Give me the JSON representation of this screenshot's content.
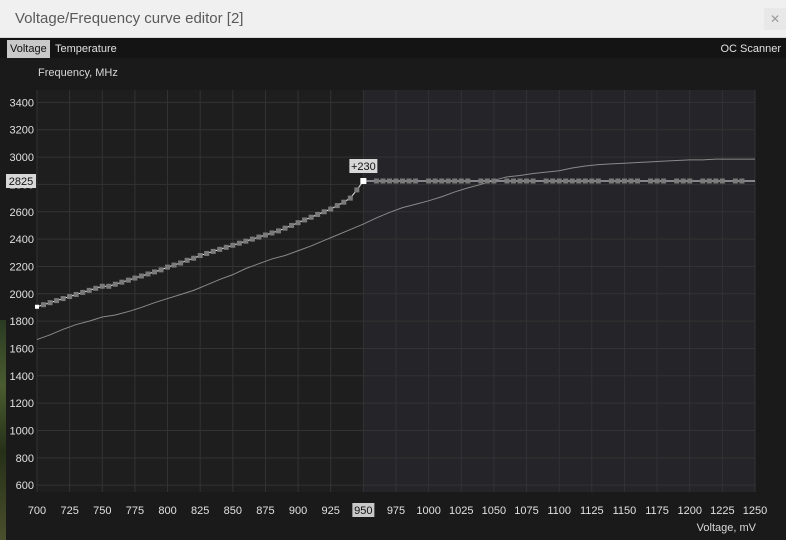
{
  "window": {
    "title": "Voltage/Frequency curve editor [2]",
    "close_icon": "close-icon"
  },
  "tabs": {
    "voltage": "Voltage",
    "temperature": "Temperature",
    "oc_scanner": "OC Scanner"
  },
  "colors": {
    "background": "#1a1a1a",
    "plot_area": "#1e1e1e",
    "plot_area_highlight": "#242429",
    "grid": "#333333",
    "curve": "#e8e8e8",
    "baseline_curve": "#8a8a8a",
    "marker": "#7a7a7a",
    "selected_marker": "#ffffff",
    "tab_active_bg": "#c9c9c9"
  },
  "chart_data": {
    "type": "line",
    "ylabel": "Frequency, MHz",
    "xlabel": "Voltage, mV",
    "xlim": [
      700,
      1250
    ],
    "ylim": [
      550,
      3450
    ],
    "grid": true,
    "x_ticks": [
      700,
      725,
      750,
      775,
      800,
      825,
      850,
      875,
      900,
      925,
      950,
      975,
      1000,
      1025,
      1050,
      1075,
      1100,
      1125,
      1150,
      1175,
      1200,
      1225,
      1250
    ],
    "y_ticks": [
      600,
      800,
      1000,
      1200,
      1400,
      1600,
      1800,
      2000,
      2200,
      2400,
      2600,
      2800,
      3000,
      3200,
      3400
    ],
    "highlighted_x_tick": "950",
    "highlighted_y_value": "2825",
    "offset_label": "+230",
    "selected_point": {
      "x": 950,
      "y": 2825
    },
    "highlight_region_x_from": 950,
    "series": [
      {
        "role": "edited-curve",
        "x": [
          700,
          705,
          710,
          715,
          720,
          725,
          730,
          735,
          740,
          745,
          750,
          755,
          760,
          765,
          770,
          775,
          780,
          785,
          790,
          795,
          800,
          805,
          810,
          815,
          820,
          825,
          830,
          835,
          840,
          845,
          850,
          855,
          860,
          865,
          870,
          875,
          880,
          885,
          890,
          895,
          900,
          905,
          910,
          915,
          920,
          925,
          930,
          935,
          940,
          945,
          950,
          1250
        ],
        "y": [
          1905,
          1920,
          1935,
          1950,
          1965,
          1980,
          1995,
          2010,
          2025,
          2040,
          2055,
          2055,
          2070,
          2085,
          2100,
          2115,
          2130,
          2145,
          2160,
          2175,
          2195,
          2210,
          2225,
          2245,
          2260,
          2280,
          2295,
          2310,
          2325,
          2340,
          2355,
          2370,
          2385,
          2400,
          2415,
          2430,
          2445,
          2460,
          2480,
          2500,
          2520,
          2540,
          2560,
          2580,
          2600,
          2620,
          2645,
          2670,
          2700,
          2760,
          2825,
          2825
        ]
      },
      {
        "role": "default-curve",
        "x": [
          700,
          710,
          720,
          730,
          740,
          750,
          760,
          770,
          780,
          790,
          800,
          810,
          820,
          830,
          840,
          850,
          860,
          870,
          880,
          890,
          900,
          910,
          920,
          930,
          940,
          950,
          960,
          970,
          980,
          990,
          1000,
          1010,
          1020,
          1030,
          1040,
          1050,
          1060,
          1070,
          1080,
          1090,
          1100,
          1110,
          1120,
          1130,
          1140,
          1150,
          1160,
          1170,
          1180,
          1190,
          1200,
          1210,
          1220,
          1230,
          1240,
          1250
        ],
        "y": [
          1665,
          1700,
          1740,
          1775,
          1800,
          1830,
          1845,
          1870,
          1900,
          1935,
          1965,
          1995,
          2025,
          2065,
          2105,
          2140,
          2185,
          2220,
          2255,
          2280,
          2315,
          2350,
          2390,
          2430,
          2470,
          2510,
          2555,
          2595,
          2630,
          2655,
          2680,
          2710,
          2745,
          2775,
          2800,
          2830,
          2855,
          2865,
          2880,
          2890,
          2900,
          2920,
          2935,
          2945,
          2950,
          2955,
          2960,
          2965,
          2970,
          2975,
          2980,
          2980,
          2985,
          2985,
          2985,
          2985
        ]
      }
    ],
    "markers_x": [
      705,
      710,
      715,
      720,
      725,
      730,
      735,
      740,
      745,
      750,
      755,
      760,
      765,
      770,
      775,
      780,
      785,
      790,
      795,
      800,
      805,
      810,
      815,
      820,
      825,
      830,
      835,
      840,
      845,
      850,
      855,
      860,
      865,
      870,
      875,
      880,
      885,
      890,
      895,
      900,
      905,
      910,
      915,
      920,
      925,
      930,
      935,
      940,
      945,
      960,
      965,
      970,
      975,
      980,
      985,
      990,
      1000,
      1005,
      1010,
      1015,
      1020,
      1025,
      1030,
      1040,
      1045,
      1050,
      1060,
      1065,
      1070,
      1075,
      1080,
      1090,
      1095,
      1100,
      1105,
      1110,
      1115,
      1120,
      1125,
      1130,
      1140,
      1145,
      1150,
      1155,
      1160,
      1170,
      1175,
      1180,
      1190,
      1195,
      1200,
      1210,
      1215,
      1220,
      1225,
      1235,
      1240
    ]
  }
}
